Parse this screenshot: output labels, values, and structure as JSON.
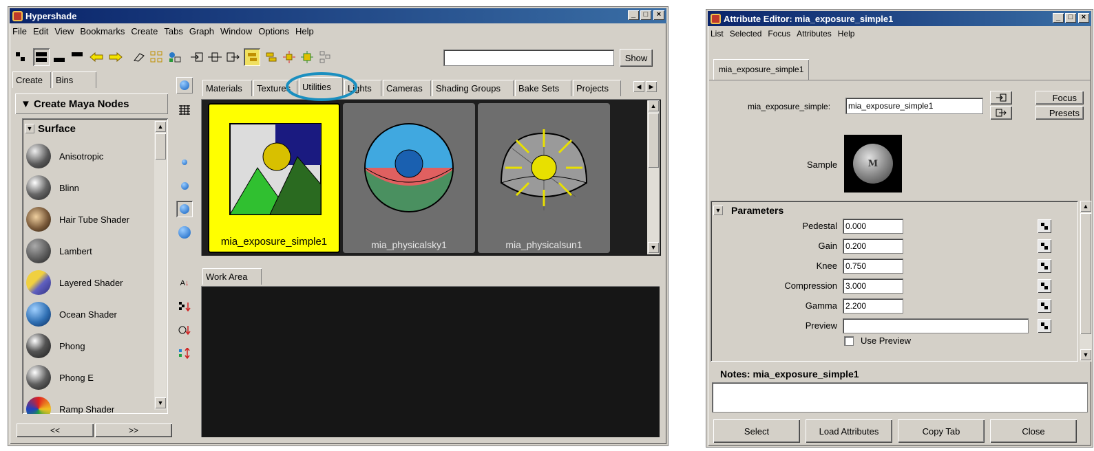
{
  "hypershade": {
    "title": "Hypershade",
    "menu": [
      "File",
      "Edit",
      "View",
      "Bookmarks",
      "Create",
      "Tabs",
      "Graph",
      "Window",
      "Options",
      "Help"
    ],
    "show_label": "Show",
    "left_tabs": [
      "Create",
      "Bins"
    ],
    "create_header": "▼ Create Maya Nodes",
    "section": "Surface",
    "nodes": [
      {
        "label": "Anisotropic",
        "color": "#5a5a5a"
      },
      {
        "label": "Blinn",
        "color": "#666666"
      },
      {
        "label": "Hair Tube Shader",
        "color": "#7a5a3a"
      },
      {
        "label": "Lambert",
        "color": "#5c5c5c"
      },
      {
        "label": "Layered Shader",
        "color": "#d9c34a"
      },
      {
        "label": "Ocean Shader",
        "color": "#2f6fb3"
      },
      {
        "label": "Phong",
        "color": "#555555"
      },
      {
        "label": "Phong E",
        "color": "#5f5f5f"
      },
      {
        "label": "Ramp Shader",
        "color": "#d84a2a"
      }
    ],
    "nav_left": "<<",
    "nav_right": ">>",
    "top_tabs": [
      "Materials",
      "Textures",
      "Utilities",
      "Lights",
      "Cameras",
      "Shading Groups",
      "Bake Sets",
      "Projects"
    ],
    "active_tab": "Utilities",
    "swatches": [
      "mia_exposure_simple1",
      "mia_physicalsky1",
      "mia_physicalsun1"
    ],
    "work_area_tab": "Work Area",
    "highlight_color": "#1a8fc0"
  },
  "attribute_editor": {
    "title": "Attribute Editor: mia_exposure_simple1",
    "menu": [
      "List",
      "Selected",
      "Focus",
      "Attributes",
      "Help"
    ],
    "node_tab": "mia_exposure_simple1",
    "node_type_label": "mia_exposure_simple:",
    "node_name": "mia_exposure_simple1",
    "focus_label": "Focus",
    "presets_label": "Presets",
    "sample_label": "Sample",
    "parameters_header": "Parameters",
    "params": [
      {
        "label": "Pedestal",
        "value": "0.000"
      },
      {
        "label": "Gain",
        "value": "0.200"
      },
      {
        "label": "Knee",
        "value": "0.750"
      },
      {
        "label": "Compression",
        "value": "3.000"
      },
      {
        "label": "Gamma",
        "value": "2.200"
      }
    ],
    "preview_label": "Preview",
    "use_preview_label": "Use Preview",
    "notes_label": "Notes:  mia_exposure_simple1",
    "buttons": [
      "Select",
      "Load Attributes",
      "Copy Tab",
      "Close"
    ]
  }
}
